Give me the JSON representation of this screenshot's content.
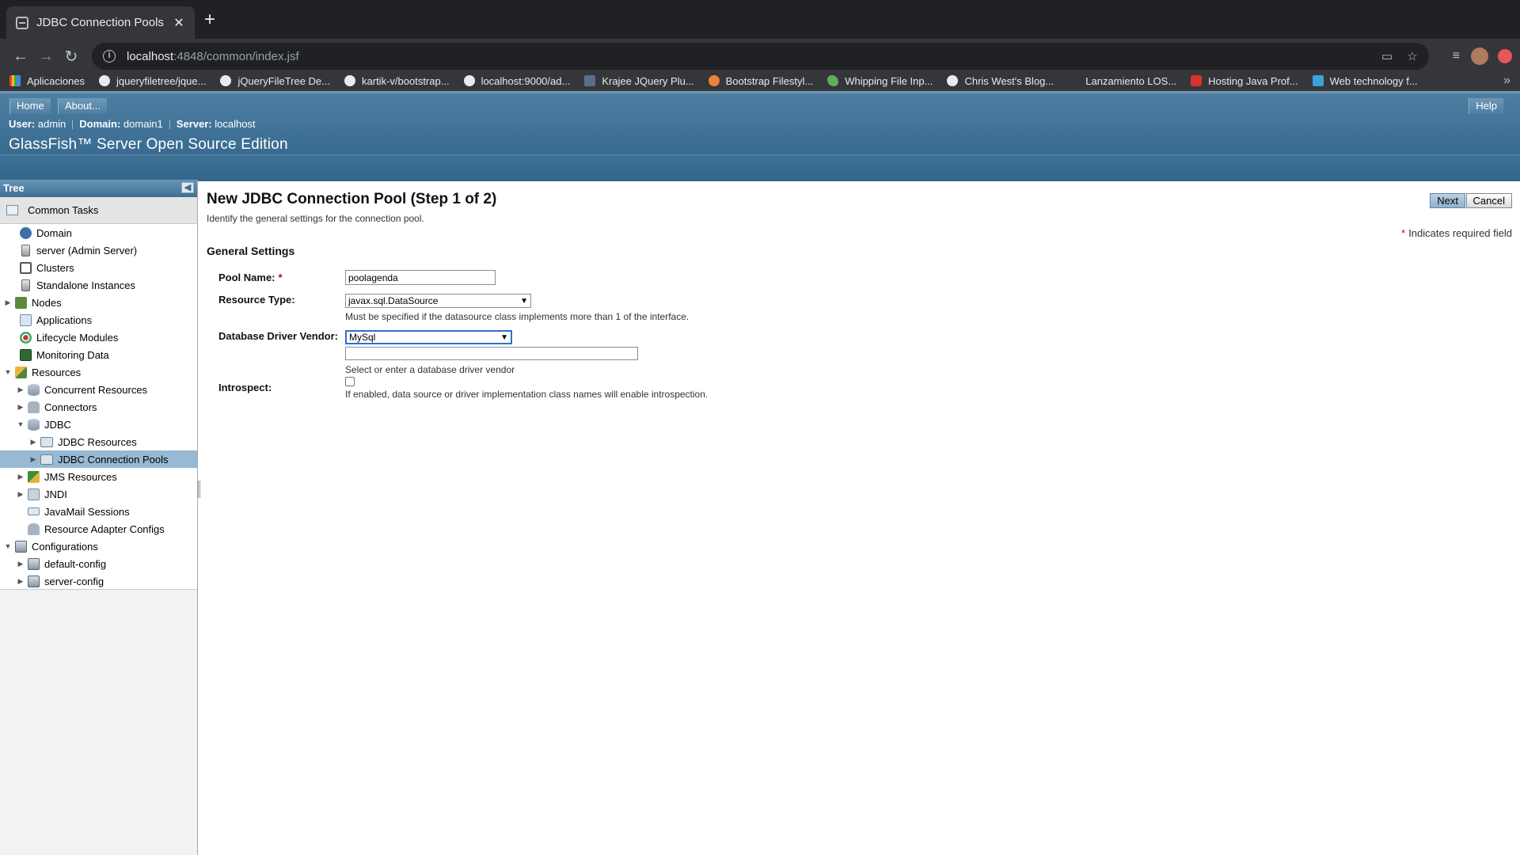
{
  "browser": {
    "tab_title": "JDBC Connection Pools",
    "url_host": "localhost",
    "url_path": ":4848/common/index.jsf",
    "bookmarks": [
      {
        "label": "Aplicaciones",
        "icon": "apps-grid-icon"
      },
      {
        "label": "jqueryfiletree/jque...",
        "icon": "github-icon"
      },
      {
        "label": "jQueryFileTree De...",
        "icon": "link-icon"
      },
      {
        "label": "kartik-v/bootstrap...",
        "icon": "github-icon"
      },
      {
        "label": "localhost:9000/ad...",
        "icon": "link-icon"
      },
      {
        "label": "Krajee JQuery Plu...",
        "icon": "krajee-icon"
      },
      {
        "label": "Bootstrap Filestyl...",
        "icon": "bootstrap-icon"
      },
      {
        "label": "Whipping File Inp...",
        "icon": "leaf-icon"
      },
      {
        "label": "Chris West's Blog...",
        "icon": "link-icon"
      },
      {
        "label": "Lanzamiento LOS...",
        "icon": "page-icon"
      },
      {
        "label": "Hosting Java Prof...",
        "icon": "hosting-icon"
      },
      {
        "label": "Web technology f...",
        "icon": "web-icon"
      }
    ]
  },
  "masthead": {
    "home": "Home",
    "about": "About...",
    "help": "Help",
    "user_label": "User:",
    "user": "admin",
    "domain_label": "Domain:",
    "domain": "domain1",
    "server_label": "Server:",
    "server": "localhost",
    "product": "GlassFish™ Server Open Source Edition"
  },
  "sidebar": {
    "header": "Tree",
    "common_tasks": "Common Tasks",
    "nodes": [
      {
        "label": "Domain"
      },
      {
        "label": "server (Admin Server)"
      },
      {
        "label": "Clusters"
      },
      {
        "label": "Standalone Instances"
      },
      {
        "label": "Nodes"
      },
      {
        "label": "Applications"
      },
      {
        "label": "Lifecycle Modules"
      },
      {
        "label": "Monitoring Data"
      },
      {
        "label": "Resources"
      },
      {
        "label": "Concurrent Resources"
      },
      {
        "label": "Connectors"
      },
      {
        "label": "JDBC"
      },
      {
        "label": "JDBC Resources"
      },
      {
        "label": "JDBC Connection Pools"
      },
      {
        "label": "JMS Resources"
      },
      {
        "label": "JNDI"
      },
      {
        "label": "JavaMail Sessions"
      },
      {
        "label": "Resource Adapter Configs"
      },
      {
        "label": "Configurations"
      },
      {
        "label": "default-config"
      },
      {
        "label": "server-config"
      }
    ]
  },
  "main": {
    "title": "New JDBC Connection Pool (Step 1 of 2)",
    "help_text": "Identify the general settings for the connection pool.",
    "next": "Next",
    "cancel": "Cancel",
    "required_note": "Indicates required field",
    "section": "General Settings",
    "pool_name_label": "Pool Name:",
    "pool_name_value": "poolagenda",
    "resource_type_label": "Resource Type:",
    "resource_type_value": "javax.sql.DataSource",
    "resource_type_hint": "Must be specified if the datasource class implements more than 1 of the interface.",
    "vendor_label": "Database Driver Vendor:",
    "vendor_value": "MySql",
    "vendor_text_value": "",
    "vendor_hint": "Select or enter a database driver vendor",
    "introspect_label": "Introspect:",
    "introspect_checked": false,
    "introspect_hint": "If enabled, data source or driver implementation class names will enable introspection."
  }
}
